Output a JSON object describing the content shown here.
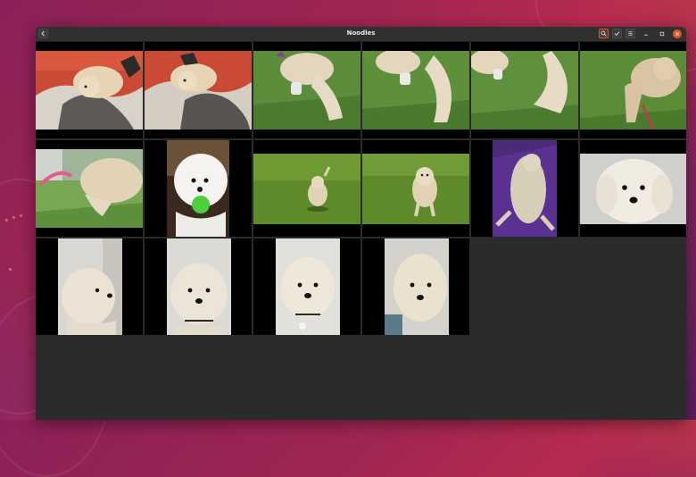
{
  "app": {
    "title": "Noodles"
  },
  "toolbar": {
    "back_icon": "chevron-left-icon",
    "search_icon": "search-icon",
    "select_icon": "checkmark-icon",
    "menu_icon": "menu-icon"
  },
  "window_controls": [
    "minimize",
    "maximize",
    "close"
  ],
  "colors": {
    "accent": "#e95420",
    "window_bg": "#2b2b2b",
    "headerbar": "#303030"
  },
  "photos": [
    {
      "subject": "dog-on-blanket-1"
    },
    {
      "subject": "dog-on-blanket-2"
    },
    {
      "subject": "dog-grass-closeup-1"
    },
    {
      "subject": "dog-grass-closeup-2"
    },
    {
      "subject": "dog-grass-closeup-3"
    },
    {
      "subject": "dog-grass-walking"
    },
    {
      "subject": "dog-with-pink-toy"
    },
    {
      "subject": "dog-with-green-ball"
    },
    {
      "subject": "dog-on-field-1"
    },
    {
      "subject": "dog-on-field-2"
    },
    {
      "subject": "dog-on-purple-blanket"
    },
    {
      "subject": "dog-portrait-1"
    },
    {
      "subject": "dog-portrait-2"
    },
    {
      "subject": "dog-portrait-3"
    },
    {
      "subject": "dog-portrait-4"
    },
    {
      "subject": "dog-portrait-5"
    }
  ]
}
